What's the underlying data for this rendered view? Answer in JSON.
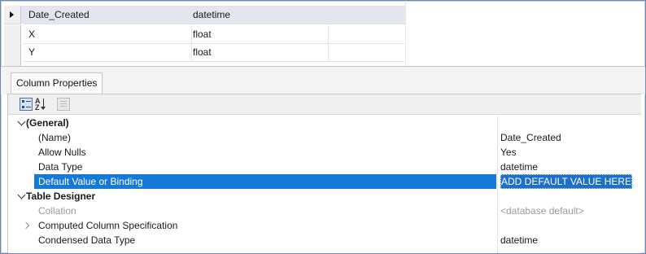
{
  "columns": [
    {
      "name": "Date_Created",
      "type": "datetime",
      "allow_nulls": true,
      "current": true
    },
    {
      "name": "X",
      "type": "float",
      "allow_nulls": true,
      "current": false
    },
    {
      "name": "Y",
      "type": "float",
      "allow_nulls": true,
      "current": false
    }
  ],
  "properties_tab": "Column Properties",
  "toolbar": {
    "categorized_icon": "categorized-icon",
    "alphabetical_icon": "sort-az-icon",
    "property_pages_icon": "property-pages-icon",
    "alphabetical_glyph_top": "A",
    "alphabetical_glyph_bottom": "Z"
  },
  "general": {
    "title": "(General)",
    "rows": [
      {
        "label": "(Name)",
        "value": "Date_Created"
      },
      {
        "label": "Allow Nulls",
        "value": "Yes"
      },
      {
        "label": "Data Type",
        "value": "datetime"
      },
      {
        "label": "Default Value or Binding",
        "value": "ADD DEFAULT VALUE HERE",
        "selected": true
      }
    ]
  },
  "table_designer": {
    "title": "Table Designer",
    "rows": [
      {
        "label": "Collation",
        "value": "<database default>",
        "muted": true
      },
      {
        "label": "Computed Column Specification",
        "value": "",
        "expandable": true
      },
      {
        "label": "Condensed Data Type",
        "value": "datetime"
      }
    ]
  },
  "colors": {
    "selection": "#1679d6",
    "accent_border": "#6d86b3"
  }
}
